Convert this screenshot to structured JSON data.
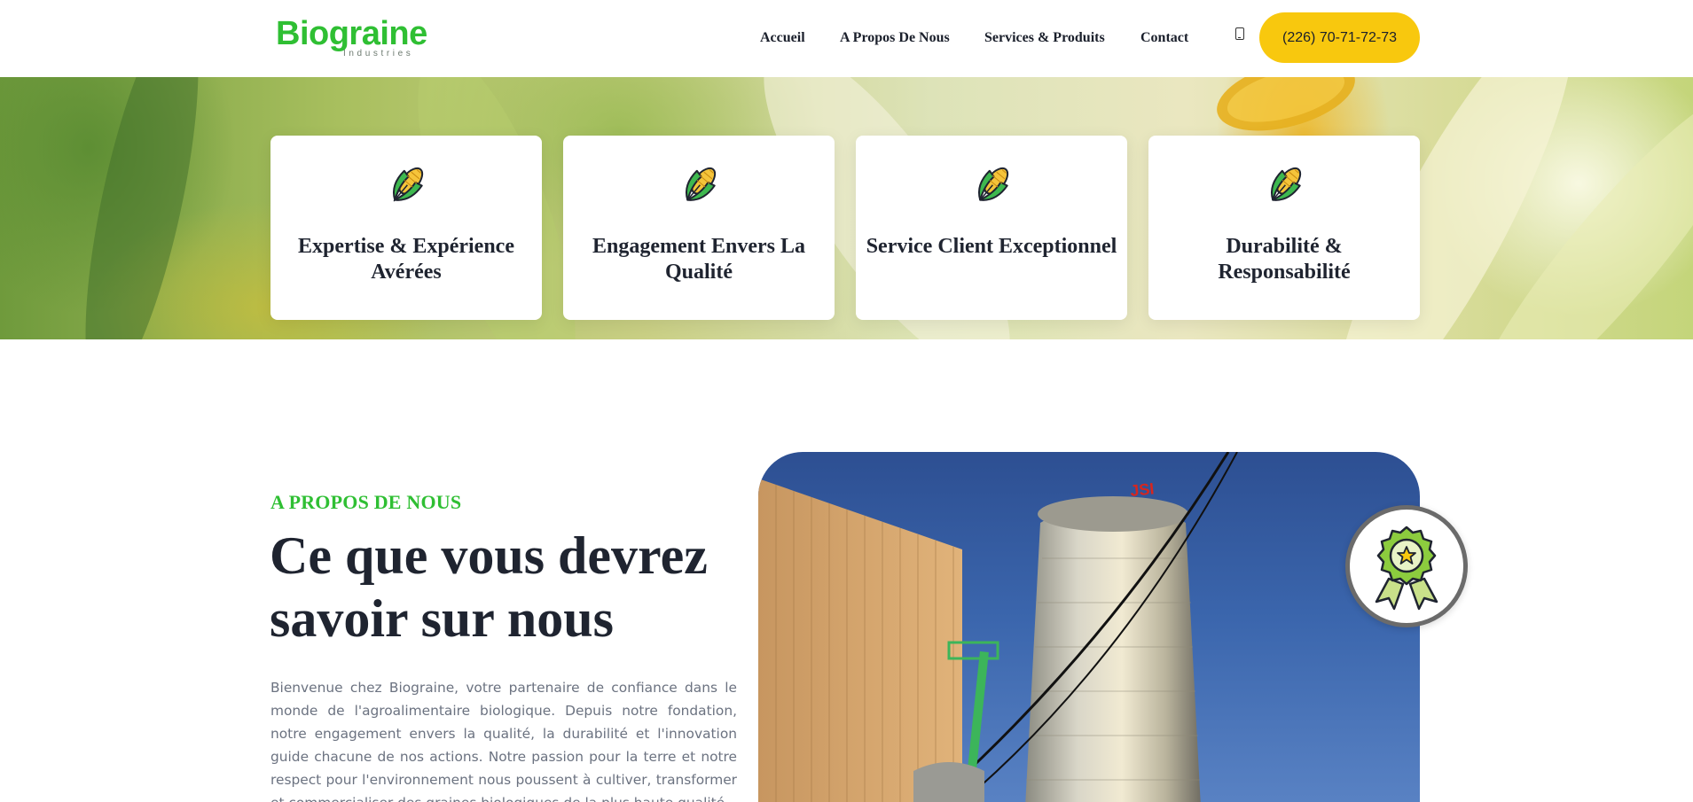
{
  "header": {
    "logo": {
      "name": "Biograine",
      "tagline": "Industries"
    },
    "nav": [
      {
        "label": "Accueil"
      },
      {
        "label": "A Propos De Nous"
      },
      {
        "label": "Services & Produits"
      },
      {
        "label": "Contact"
      }
    ],
    "mobile_icon": "mobile-phone-icon",
    "phone_button": "(226) 70-71-72-73"
  },
  "features": [
    {
      "icon": "corn-icon",
      "title": "Expertise & Expérience Avérées"
    },
    {
      "icon": "corn-icon",
      "title": "Engagement Envers La Qualité"
    },
    {
      "icon": "corn-icon",
      "title": "Service Client Exceptionnel"
    },
    {
      "icon": "corn-icon",
      "title": "Durabilité & Responsabilité"
    }
  ],
  "about": {
    "eyebrow": "A PROPOS DE NOUS",
    "title": "Ce que vous devrez savoir sur nous",
    "text": "Bienvenue chez Biograine, votre partenaire de confiance dans le monde de l'agroalimentaire biologique. Depuis notre fondation, notre engagement envers la qualité, la durabilité et l'innovation guide chacune de nos actions. Notre passion pour la terre et notre respect pour l'environnement nous poussent à cultiver, transformer et commercialiser des graines biologiques de la plus haute qualité.",
    "image": "grain-silo-photo",
    "badge_icon": "award-ribbon-icon"
  },
  "colors": {
    "brand_green": "#2fbf33",
    "accent_yellow": "#f8c80e",
    "heading": "#1f2430",
    "body_text": "#6b7280"
  }
}
